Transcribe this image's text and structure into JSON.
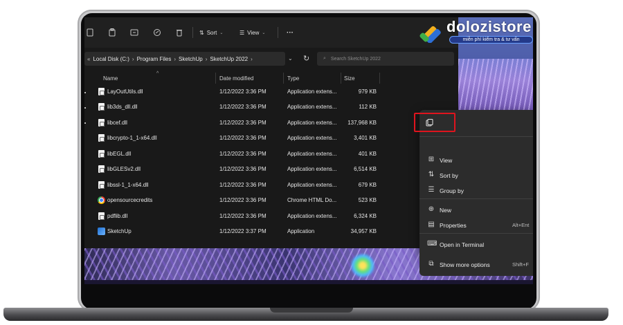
{
  "toolbar": {
    "buttons": [
      {
        "icon": "cut-icon"
      },
      {
        "icon": "paste-icon"
      },
      {
        "icon": "rename-icon"
      },
      {
        "icon": "share-icon"
      },
      {
        "icon": "delete-icon"
      }
    ],
    "sort_label": "Sort",
    "view_label": "View",
    "more_label": "···"
  },
  "address": {
    "breadcrumbs": [
      "Local Disk (C:)",
      "Program Files",
      "SketchUp",
      "SketchUp 2022"
    ],
    "separator": "›",
    "search_placeholder": "Search SketchUp 2022"
  },
  "columns": {
    "name": "Name",
    "date": "Date modified",
    "type": "Type",
    "size": "Size"
  },
  "files": [
    {
      "name": "LayOutUtils.dll",
      "date": "1/12/2022 3:36 PM",
      "type": "Application extens...",
      "size": "979 KB",
      "icon": "dll-file-icon"
    },
    {
      "name": "lib3ds_dll.dll",
      "date": "1/12/2022 3:36 PM",
      "type": "Application extens...",
      "size": "112 KB",
      "icon": "dll-file-icon"
    },
    {
      "name": "libcef.dll",
      "date": "1/12/2022 3:36 PM",
      "type": "Application extens...",
      "size": "137,968 KB",
      "icon": "dll-file-icon"
    },
    {
      "name": "libcrypto-1_1-x64.dll",
      "date": "1/12/2022 3:36 PM",
      "type": "Application extens...",
      "size": "3,401 KB",
      "icon": "dll-file-icon"
    },
    {
      "name": "libEGL.dll",
      "date": "1/12/2022 3:36 PM",
      "type": "Application extens...",
      "size": "401 KB",
      "icon": "dll-file-icon"
    },
    {
      "name": "libGLESv2.dll",
      "date": "1/12/2022 3:36 PM",
      "type": "Application extens...",
      "size": "6,514 KB",
      "icon": "dll-file-icon"
    },
    {
      "name": "libssl-1_1-x64.dll",
      "date": "1/12/2022 3:36 PM",
      "type": "Application extens...",
      "size": "679 KB",
      "icon": "dll-file-icon"
    },
    {
      "name": "opensourcecredits",
      "date": "1/12/2022 3:36 PM",
      "type": "Chrome HTML Do...",
      "size": "523 KB",
      "icon": "chrome-icon"
    },
    {
      "name": "pdflib.dll",
      "date": "1/12/2022 3:36 PM",
      "type": "Application extens...",
      "size": "6,324 KB",
      "icon": "dll-file-icon"
    },
    {
      "name": "SketchUp",
      "date": "1/12/2022 3:37 PM",
      "type": "Application",
      "size": "34,957 KB",
      "icon": "sketchup-app-icon"
    }
  ],
  "context_menu": {
    "top_icon": "copy-path-icon",
    "items": [
      {
        "label": "View",
        "icon": "view-grid-icon",
        "shortcut": ""
      },
      {
        "label": "Sort by",
        "icon": "sort-icon",
        "shortcut": ""
      },
      {
        "label": "Group by",
        "icon": "group-icon",
        "shortcut": ""
      },
      {
        "label": "New",
        "icon": "new-plus-icon",
        "shortcut": ""
      },
      {
        "label": "Properties",
        "icon": "properties-icon",
        "shortcut": "Alt+Ent"
      },
      {
        "label": "Open in Terminal",
        "icon": "terminal-icon",
        "shortcut": ""
      },
      {
        "label": "Show more options",
        "icon": "more-options-icon",
        "shortcut": "Shift+F"
      }
    ],
    "highlight_color": "#e0141e"
  },
  "watermark": {
    "brand": "dolozistore",
    "tagline": "miễn phí kiểm tra & tư vấn"
  },
  "colors": {
    "window_bg": "#191919",
    "menu_bg": "#2c2c2c",
    "text": "#e6e6e6"
  }
}
